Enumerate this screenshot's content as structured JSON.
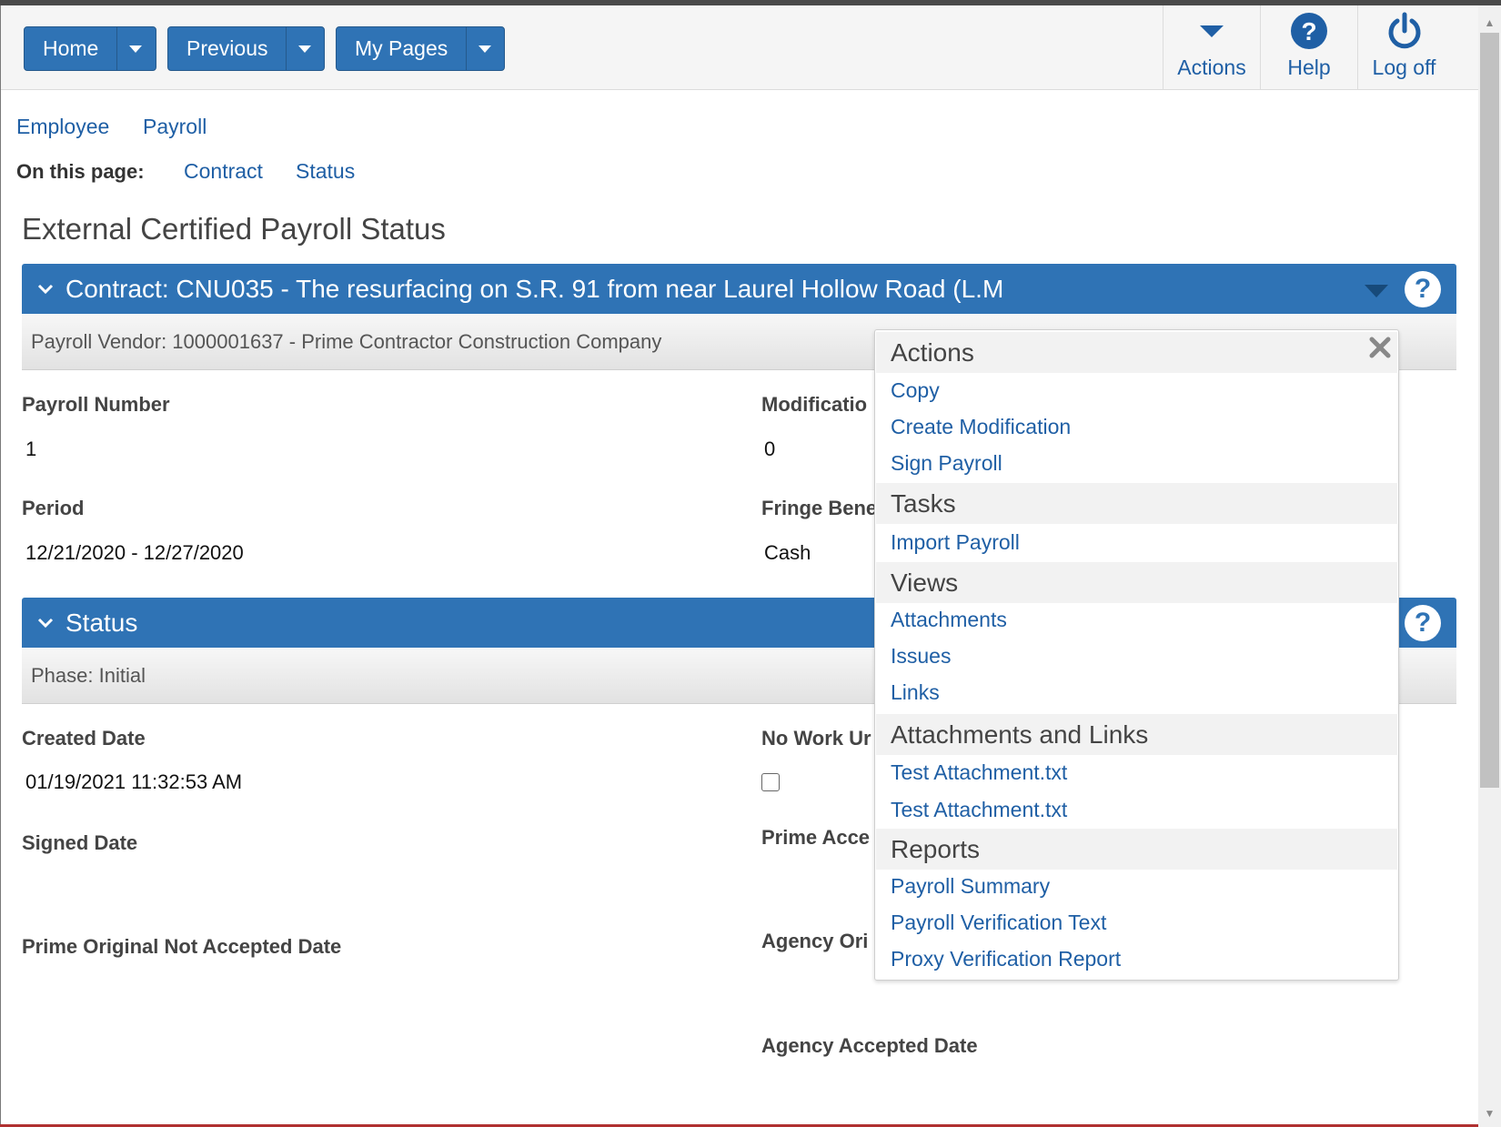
{
  "nav": {
    "home_label": "Home",
    "previous_label": "Previous",
    "mypages_label": "My Pages"
  },
  "header_actions": {
    "actions_label": "Actions",
    "help_label": "Help",
    "logoff_label": "Log off"
  },
  "breadcrumbs": {
    "employee": "Employee",
    "payroll": "Payroll"
  },
  "on_this_page": {
    "label": "On this page:",
    "contract": "Contract",
    "status": "Status"
  },
  "page_title": "External Certified Payroll Status",
  "contract_section": {
    "title": "Contract: CNU035 - The resurfacing on S.R. 91 from near Laurel Hollow Road (L.M",
    "subtitle": "Payroll Vendor: 1000001637 - Prime Contractor Construction Company"
  },
  "fields": {
    "payroll_number_label": "Payroll Number",
    "payroll_number_value": "1",
    "modification_label": "Modificatio",
    "modification_value": "0",
    "period_label": "Period",
    "period_value": "12/21/2020 - 12/27/2020",
    "fringe_label": "Fringe Bene",
    "fringe_value": "Cash"
  },
  "status_section": {
    "title": "Status",
    "subtitle": "Phase: Initial"
  },
  "status_fields": {
    "created_date_label": "Created Date",
    "created_date_value": "01/19/2021 11:32:53 AM",
    "no_work_label": "No Work Ur",
    "signed_date_label": "Signed Date",
    "prime_accepted_label": "Prime Acce",
    "prime_original_label": "Prime Original Not Accepted Date",
    "agency_original_label": "Agency Ori",
    "agency_accepted_label": "Agency Accepted Date"
  },
  "actions_menu": {
    "actions_header": "Actions",
    "copy": "Copy",
    "create_modification": "Create Modification",
    "sign_payroll": "Sign Payroll",
    "tasks_header": "Tasks",
    "import_payroll": "Import Payroll",
    "views_header": "Views",
    "attachments": "Attachments",
    "issues": "Issues",
    "links": "Links",
    "attachments_links_header": "Attachments and Links",
    "attachment_1": "Test Attachment.txt",
    "attachment_2": "Test Attachment.txt",
    "reports_header": "Reports",
    "payroll_summary": "Payroll Summary",
    "payroll_verification_text": "Payroll Verification Text",
    "proxy_verification_report": "Proxy Verification Report"
  },
  "colors": {
    "primary_blue": "#2f73b5",
    "link_blue": "#1f5fa5"
  }
}
